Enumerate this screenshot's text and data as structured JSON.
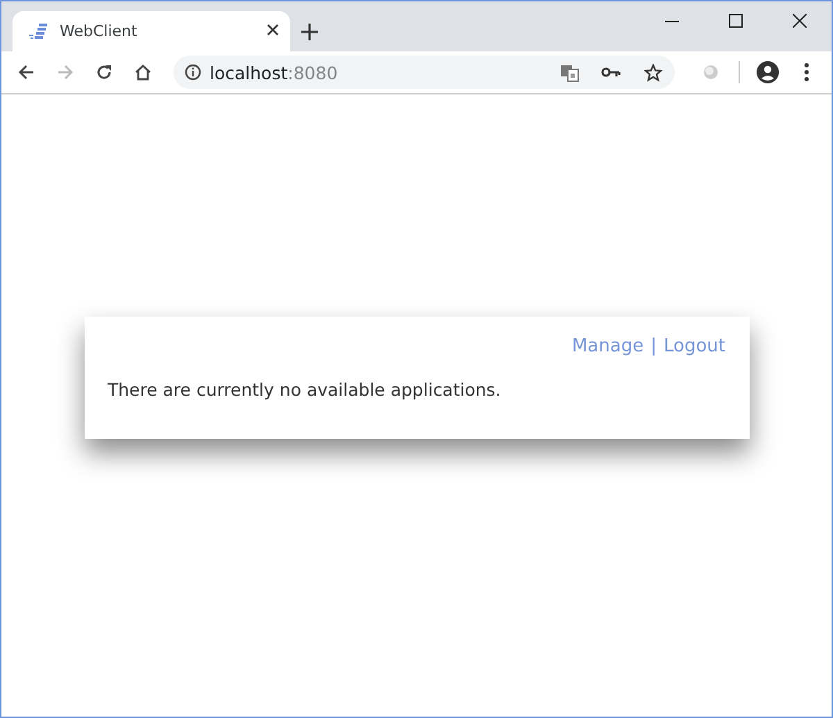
{
  "browser": {
    "tab": {
      "title": "WebClient",
      "selected": true
    },
    "url": {
      "host": "localhost",
      "port": ":8080"
    },
    "back_disabled": false,
    "forward_disabled": true
  },
  "card": {
    "links": [
      {
        "label": "Manage"
      },
      {
        "label": "Logout"
      }
    ],
    "separator": "|",
    "message": "There are currently no available applications."
  }
}
